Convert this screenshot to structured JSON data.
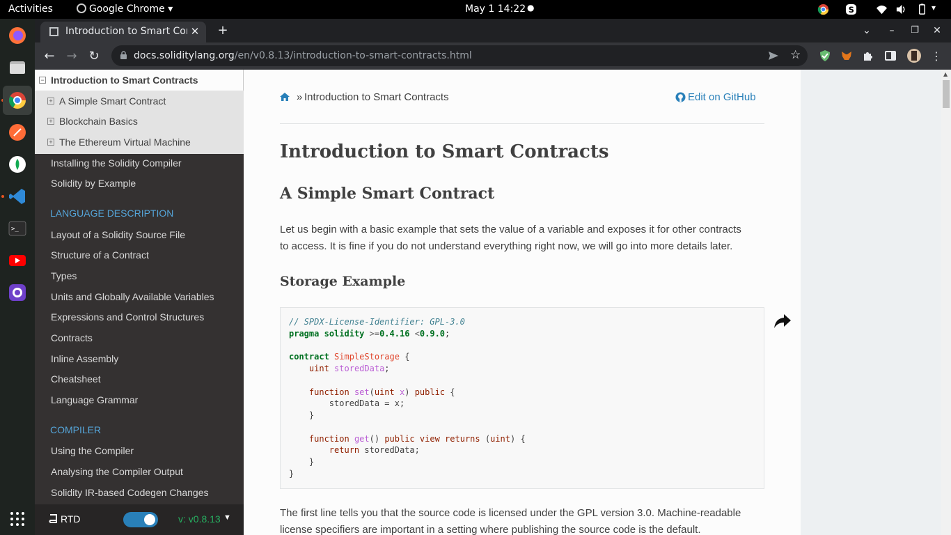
{
  "topbar": {
    "activities": "Activities",
    "app_name": "Google Chrome",
    "datetime": "May 1  14:22"
  },
  "browser": {
    "tab_title": "Introduction to Smart Contracts",
    "url_host": "docs.soliditylang.org",
    "url_path": "/en/v0.8.13/introduction-to-smart-contracts.html"
  },
  "sidebar": {
    "current": "Introduction to Smart Contracts",
    "subitems": [
      "A Simple Smart Contract",
      "Blockchain Basics",
      "The Ethereum Virtual Machine"
    ],
    "links_top": [
      "Installing the Solidity Compiler",
      "Solidity by Example"
    ],
    "caption_lang": "LANGUAGE DESCRIPTION",
    "links_lang": [
      "Layout of a Solidity Source File",
      "Structure of a Contract",
      "Types",
      "Units and Globally Available Variables",
      "Expressions and Control Structures",
      "Contracts",
      "Inline Assembly",
      "Cheatsheet",
      "Language Grammar"
    ],
    "caption_compiler": "COMPILER",
    "links_compiler": [
      "Using the Compiler",
      "Analysing the Compiler Output",
      "Solidity IR-based Codegen Changes"
    ]
  },
  "rtd": {
    "label": "RTD",
    "version": "v: v0.8.13"
  },
  "content": {
    "breadcrumb_sep": "»",
    "breadcrumb_current": "Introduction to Smart Contracts",
    "edit_link": "Edit on GitHub",
    "h1": "Introduction to Smart Contracts",
    "h2": "A Simple Smart Contract",
    "intro_line1": "Let us begin with a basic example that sets the value of a variable and exposes it for other contracts",
    "intro_line2": "to access. It is fine if you do not understand everything right now, we will go into more details later.",
    "h3": "Storage Example",
    "after_line1": "The first line tells you that the source code is licensed under the GPL version 3.0. Machine-readable",
    "after_line2": "license specifiers are important in a setting where publishing the source code is the default."
  },
  "code": {
    "l1": "// SPDX-License-Identifier: GPL-3.0",
    "l2_kw1": "pragma",
    "l2_kw2": "solidity",
    "l2_op1": ">=",
    "l2_v1": "0.4.16",
    "l2_op2": "<",
    "l2_v2": "0.9.0",
    "l2_end": ";",
    "l4_kw": "contract",
    "l4_name": "SimpleStorage",
    "l4_brace": "{",
    "l5_type": "uint",
    "l5_var": "storedData",
    "l5_end": ";",
    "l7_kw": "function",
    "l7_name": "set",
    "l7_p1": "(",
    "l7_type": "uint",
    "l7_arg": "x",
    "l7_p2": ") ",
    "l7_mod": "public",
    "l7_brace": " {",
    "l8": "storedData = x;",
    "l9": "}",
    "l11_kw": "function",
    "l11_name": "get",
    "l11_p": "() ",
    "l11_mod1": "public",
    "l11_mod2": "view",
    "l11_ret": "returns",
    "l11_type": "uint",
    "l11_brace": " {",
    "l12_kw": "return",
    "l12_rest": " storedData;",
    "l13": "}",
    "l14": "}"
  },
  "colors": {
    "sidebar_bg": "#343131",
    "link_blue": "#2980b9",
    "caption_blue": "#55a5d9",
    "comment": "#408090",
    "keyword": "#007020",
    "number": "#208050",
    "class_name": "#0e84b5",
    "func_name": "#06287e"
  }
}
